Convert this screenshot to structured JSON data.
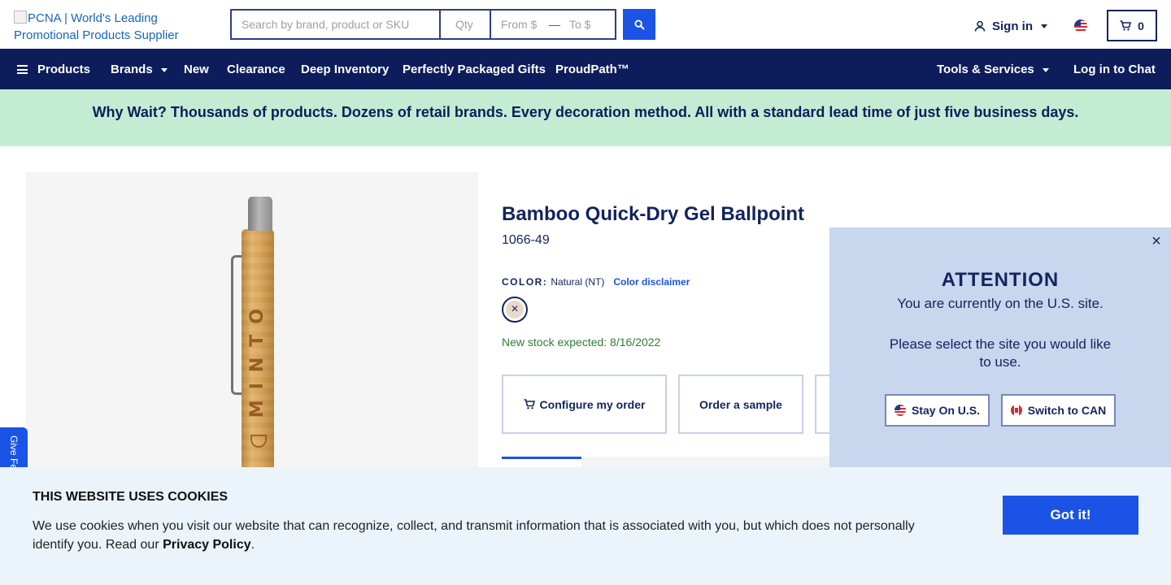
{
  "header": {
    "logo_alt": "PCNA | World's Leading Promotional Products Supplier",
    "search_placeholder": "Search by brand, product or SKU",
    "qty_placeholder": "Qty",
    "from_placeholder": "From $",
    "to_placeholder": "To $",
    "range_separator": "—",
    "signin_label": "Sign in",
    "cart_count": "0"
  },
  "nav": {
    "items": [
      "Products",
      "Brands",
      "New",
      "Clearance",
      "Deep Inventory",
      "Perfectly Packaged Gifts",
      "ProudPath™"
    ],
    "tools_label": "Tools & Services",
    "chat_label": "Log in to Chat"
  },
  "banner": {
    "text": "Why Wait? Thousands of products. Dozens of retail brands. Every decoration method. All with a standard lead time of just five business days."
  },
  "product": {
    "imprint": "MINTO",
    "title": "Bamboo Quick-Dry Gel Ballpoint",
    "sku": "1066-49",
    "color_label": "COLOR:",
    "color_value": "Natural (NT)",
    "color_disclaimer": "Color disclaimer",
    "stock_message": "New stock expected: 8/16/2022",
    "configure_label": "Configure my order",
    "sample_label": "Order a sample"
  },
  "feedback": {
    "label": "Give Fe"
  },
  "modal": {
    "close_symbol": "×",
    "title": "ATTENTION",
    "message1": "You are currently on the U.S. site.",
    "message2": "Please select the site you would like to use.",
    "stay_label": "Stay On U.S.",
    "switch_label": "Switch to CAN"
  },
  "cookie": {
    "title": "THIS WEBSITE USES COOKIES",
    "text": "We use cookies when you visit our website that can recognize, collect, and transmit information that is associated with you, but which does not personally identify you. Read our ",
    "policy_link": "Privacy Policy",
    "text_end": ".",
    "button_label": "Got it!"
  },
  "colors": {
    "navy": "#0d1d5c",
    "accent_blue": "#1a53e5",
    "banner_green": "#c3ecd3",
    "stock_green": "#2e7d32",
    "modal_bg": "#c8d6ee",
    "cookie_bg": "#ebf3fb"
  },
  "icons": [
    "search-icon",
    "user-icon",
    "cart-icon",
    "flag-us-icon",
    "flag-ca-icon",
    "close-icon",
    "hamburger-icon",
    "chevron-down-icon"
  ]
}
